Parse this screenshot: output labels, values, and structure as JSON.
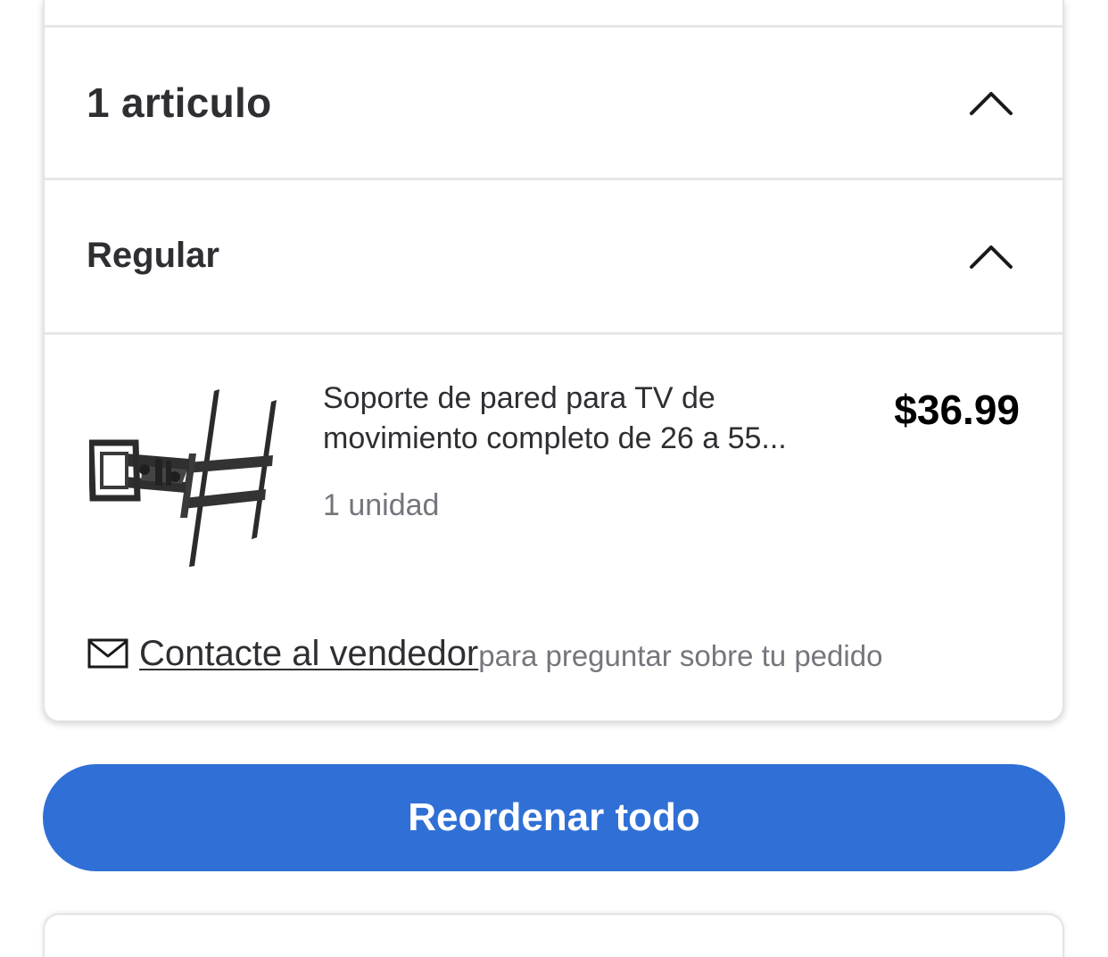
{
  "order": {
    "items_heading": "1 articulo",
    "group_heading": "Regular",
    "product": {
      "name": "Soporte de pared para TV de movimiento completo de 26 a 55...",
      "quantity": "1 unidad",
      "price": "$36.99",
      "image_icon": "tv-wall-mount-image"
    },
    "contact": {
      "link_label": "Contacte al vendedor",
      "suffix": "para preguntar sobre tu pedido",
      "icon": "mail-icon"
    }
  },
  "actions": {
    "reorder_label": "Reordenar todo"
  },
  "colors": {
    "primary_button": "#3070d6",
    "text_primary": "#2e2f32",
    "text_secondary": "#74767c",
    "divider": "#e6e7e8"
  }
}
